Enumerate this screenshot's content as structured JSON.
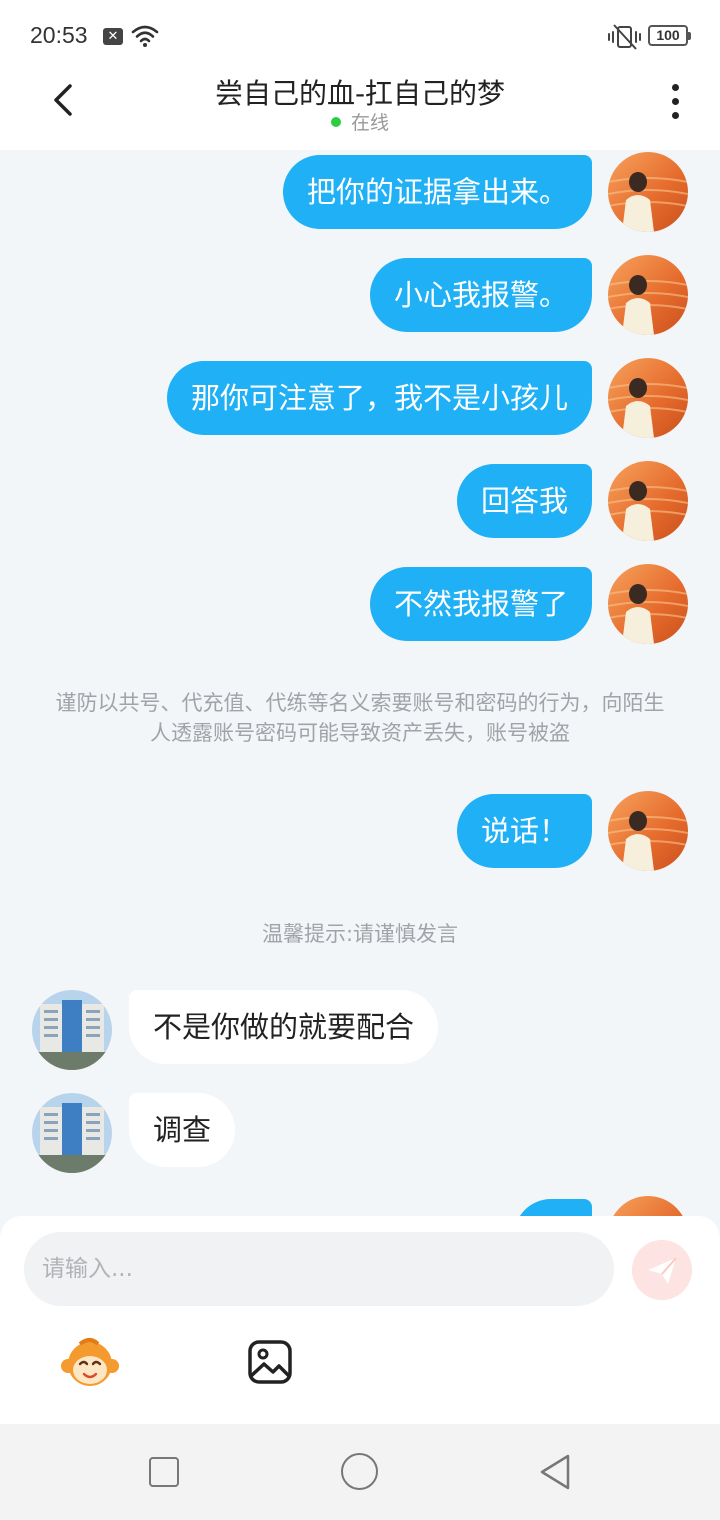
{
  "status_bar": {
    "time": "20:53",
    "notification_icon": "close-box-icon",
    "battery": "100"
  },
  "header": {
    "title": "尝自己的血-扛自己的梦",
    "online_status": "在线",
    "online_color": "#2ecc40"
  },
  "colors": {
    "bubble_out": "#1fb0f5",
    "bubble_in": "#ffffff",
    "background": "#f3f6f9",
    "send_button": "#fde3e1"
  },
  "messages": [
    {
      "side": "out",
      "text": "把你的证据拿出来。"
    },
    {
      "side": "out",
      "text": "小心我报警。"
    },
    {
      "side": "out",
      "text": "那你可注意了，我不是小孩儿"
    },
    {
      "side": "out",
      "text": "回答我"
    },
    {
      "side": "out",
      "text": "不然我报警了"
    },
    {
      "side": "system",
      "text": "谨防以共号、代充值、代练等名义索要账号和密码的行为，向陌生人透露账号密码可能导致资产丢失，账号被盗"
    },
    {
      "side": "out",
      "text": "说话！"
    },
    {
      "side": "tip",
      "text": "温馨提示:请谨慎发言"
    },
    {
      "side": "in",
      "text": "不是你做的就要配合"
    },
    {
      "side": "in",
      "text": "调查"
    }
  ],
  "input": {
    "placeholder": "请输入..."
  },
  "toolbar": {
    "emoji_icon": "monkey-emoji-icon",
    "image_icon": "image-icon",
    "send_icon": "paper-plane-icon"
  },
  "nav": {
    "recent_icon": "square-recent-icon",
    "home_icon": "circle-home-icon",
    "back_icon": "triangle-back-icon"
  }
}
